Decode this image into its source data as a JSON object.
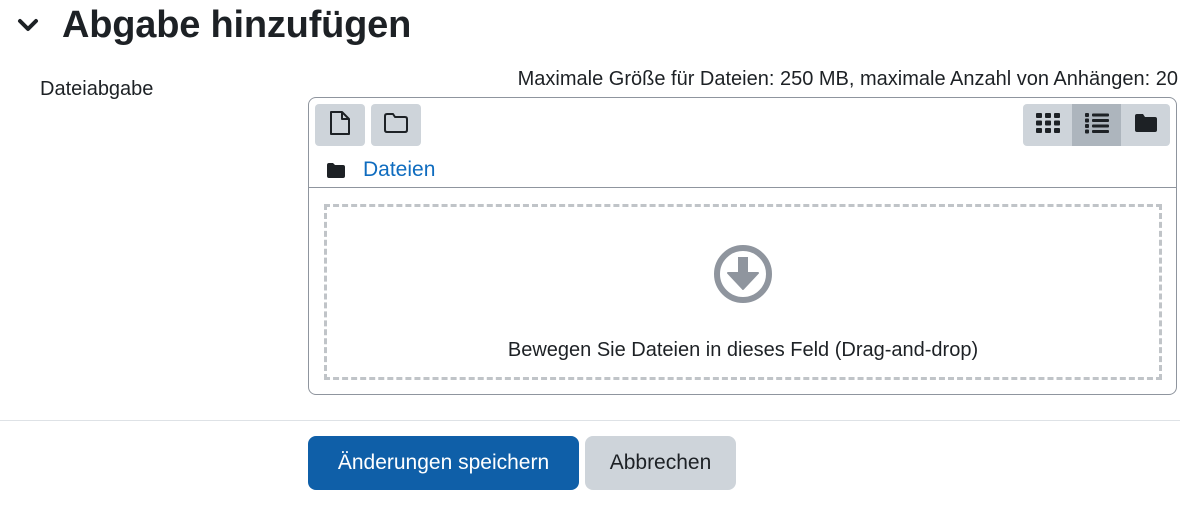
{
  "section": {
    "title": "Abgabe hinzufügen",
    "collapse_icon": "chevron-down-icon"
  },
  "field": {
    "label": "Dateiabgabe",
    "limits": "Maximale Größe für Dateien: 250 MB, maximale Anzahl von Anhängen: 20"
  },
  "filemanager": {
    "toolbar": {
      "add_file_icon": "file-icon",
      "create_folder_icon": "folder-outline-icon",
      "view_modes": [
        {
          "icon": "grid-icon",
          "active": false
        },
        {
          "icon": "list-icon",
          "active": true
        },
        {
          "icon": "folder-tree-icon",
          "active": false
        }
      ]
    },
    "breadcrumb": {
      "icon": "folder-icon",
      "label": "Dateien"
    },
    "dropzone": {
      "icon": "circle-arrow-down-icon",
      "text": "Bewegen Sie Dateien in dieses Feld (Drag-and-drop)"
    }
  },
  "actions": {
    "save_label": "Änderungen speichern",
    "cancel_label": "Abbrechen"
  },
  "colors": {
    "primary": "#0f5fa8",
    "link": "#0f6cbf",
    "secondary_button": "#ced4da",
    "active_view_button": "#adb5bd",
    "text": "#1d2125"
  }
}
